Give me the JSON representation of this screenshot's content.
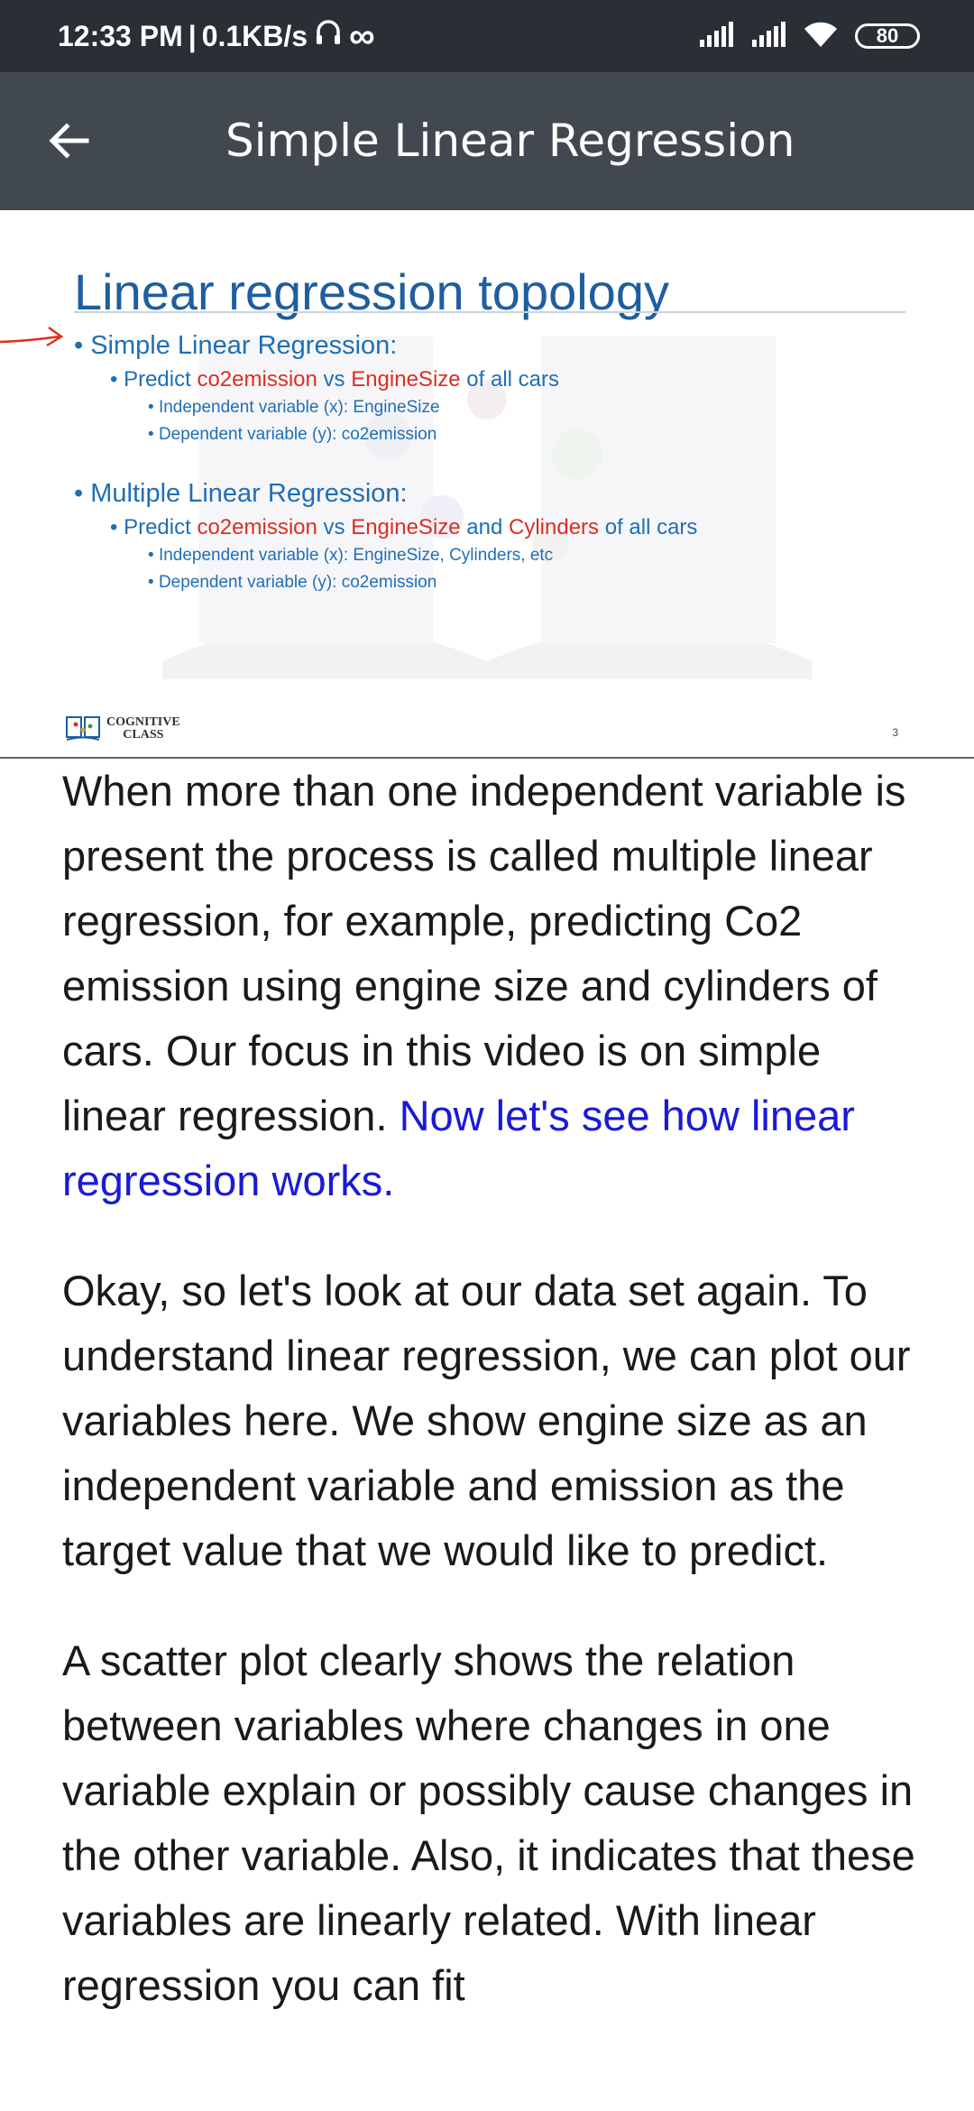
{
  "status_bar": {
    "time": "12:33 PM",
    "separator": "|",
    "network_speed": "0.1KB/s",
    "icons": [
      "headset-icon",
      "infinity-icon",
      "signal-icon",
      "signal-icon",
      "wifi-icon"
    ],
    "infinity_glyph": "∞",
    "battery": "80"
  },
  "app_bar": {
    "back_icon": "arrow-left-icon",
    "title": "Simple Linear Regression"
  },
  "slide": {
    "title": "Linear regression topology",
    "simple": {
      "heading": "Simple Linear Regression:",
      "predict": [
        "Predict ",
        "co2emission",
        " vs ",
        "EngineSize",
        " of all cars"
      ],
      "independent": "Independent variable (x): EngineSize",
      "dependent": "Dependent variable (y): co2emission"
    },
    "multiple": {
      "heading": "Multiple Linear Regression:",
      "predict": [
        "Predict ",
        "co2emission",
        " vs ",
        "EngineSize",
        " and ",
        "Cylinders",
        " of all cars"
      ],
      "independent": "Independent variable (x): EngineSize, Cylinders, etc",
      "dependent": "Dependent variable (y): co2emission"
    },
    "bullet_glyph": "•",
    "logo_line1": "COGNITIVE",
    "logo_line2": "CLASS",
    "page_number": "3",
    "colors": {
      "title": "#1f5e9e",
      "text": "#1f6fb5",
      "highlight": "#d93025",
      "annotation": "#e0301e"
    }
  },
  "transcript": {
    "paragraphs": [
      {
        "text": "When more than one independent variable is present the process is called multiple linear regression, for example, predicting Co2 emission using engine size and cylinders of cars. Our focus in this video is on simple linear regression. ",
        "highlight": "Now let's see how linear regression works."
      },
      {
        "text": "Okay, so let's look at our data set again. To understand linear regression, we can plot our variables here. We show engine size as an independent variable and emission as the target value that we would like to predict."
      },
      {
        "text": "A scatter plot clearly shows the relation between variables where changes in one variable explain or possibly cause changes in the other variable. Also, it indicates that these variables are linearly related. With linear regression you can fit"
      }
    ],
    "colors": {
      "text": "#1a1a1a",
      "highlight": "#1a1ad6"
    }
  }
}
